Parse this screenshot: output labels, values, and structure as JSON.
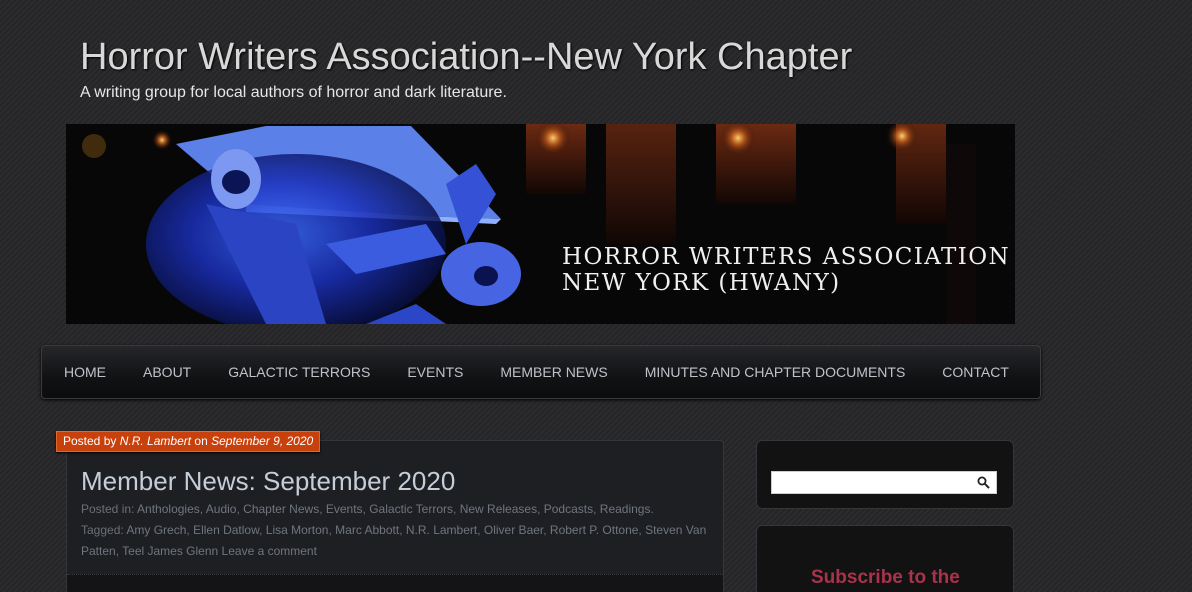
{
  "header": {
    "title": "Horror Writers Association--New York Chapter",
    "tagline": "A writing group for local authors of horror and dark literature."
  },
  "banner": {
    "line1": "HORROR WRITERS ASSOCIATION",
    "line2": "NEW YORK (HWANY)"
  },
  "nav": {
    "items": [
      {
        "label": "HOME"
      },
      {
        "label": "ABOUT"
      },
      {
        "label": "GALACTIC TERRORS"
      },
      {
        "label": "EVENTS"
      },
      {
        "label": "MEMBER NEWS"
      },
      {
        "label": "MINUTES AND CHAPTER DOCUMENTS"
      },
      {
        "label": "CONTACT"
      }
    ]
  },
  "post": {
    "posted_by_prefix": "Posted by",
    "author": "N.R. Lambert",
    "on": "on",
    "date": "September 9, 2020",
    "title": "Member News: September 2020",
    "posted_in_label": "Posted in:",
    "categories": [
      "Anthologies",
      "Audio",
      "Chapter News",
      "Events",
      "Galactic Terrors",
      "New Releases",
      "Podcasts",
      "Readings"
    ],
    "tagged_label": "Tagged:",
    "tags": [
      "Amy Grech",
      "Ellen Datlow",
      "Lisa Morton",
      "Marc Abbott",
      "N.R. Lambert",
      "Oliver Baer",
      "Robert P. Ottone",
      "Steven Van Patten",
      "Teel James Glenn"
    ],
    "comment_link": "Leave a comment"
  },
  "sidebar": {
    "search": {
      "placeholder": "",
      "icon": "search-icon"
    },
    "subscribe_title": "Subscribe to the Galactic Terrors"
  },
  "colors": {
    "accent_orange": "#c8410c",
    "subscribe_red": "#a8334a"
  }
}
